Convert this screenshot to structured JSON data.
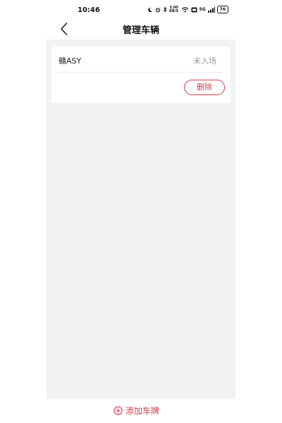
{
  "status_bar": {
    "time": "10:46",
    "network_speed": "3.00 KB/S",
    "network_type": "5G",
    "battery": "76"
  },
  "header": {
    "title": "管理车辆"
  },
  "vehicles": [
    {
      "plate": "赣ASY",
      "status": "未入场",
      "delete_label": "删除"
    }
  ],
  "footer": {
    "add_label": "添加车牌"
  },
  "colors": {
    "accent": "#d93a4a",
    "background": "#f2f2f2",
    "muted_text": "#9a9a9a"
  }
}
